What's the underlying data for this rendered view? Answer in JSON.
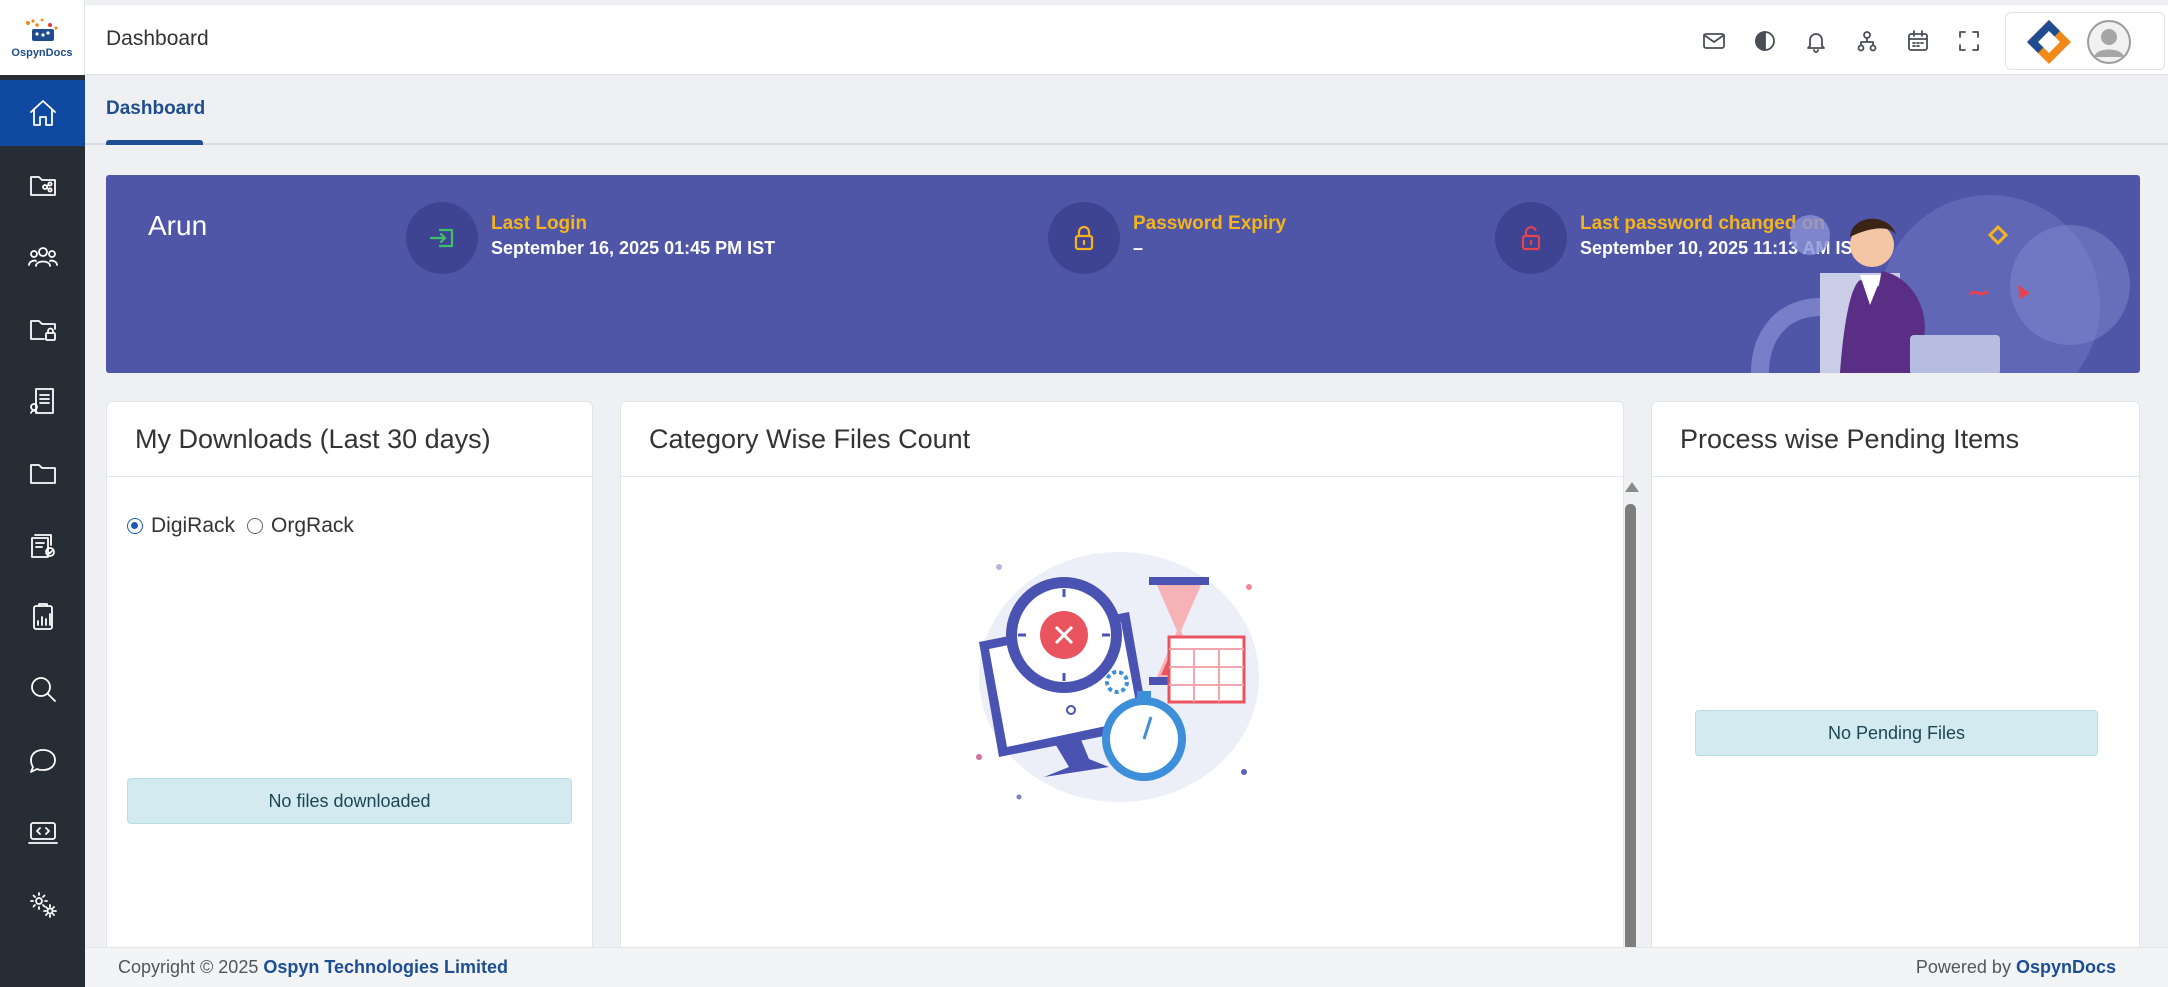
{
  "app": {
    "name": "OspynDocs"
  },
  "header": {
    "title": "Dashboard"
  },
  "header_icons": [
    "mail-icon",
    "theme-contrast-icon",
    "bell-icon",
    "org-hierarchy-icon",
    "calendar-icon",
    "fullscreen-icon"
  ],
  "sidebar": {
    "items": [
      {
        "icon": "home-icon",
        "active": true
      },
      {
        "icon": "shared-folder-icon"
      },
      {
        "icon": "users-icon"
      },
      {
        "icon": "locked-folder-icon"
      },
      {
        "icon": "document-icon"
      },
      {
        "icon": "folder-icon"
      },
      {
        "icon": "approval-docs-icon"
      },
      {
        "icon": "report-icon"
      },
      {
        "icon": "search-icon"
      },
      {
        "icon": "chat-icon"
      },
      {
        "icon": "code-screen-icon"
      },
      {
        "icon": "settings-icon"
      }
    ]
  },
  "tabs": [
    {
      "label": "Dashboard",
      "active": true
    }
  ],
  "banner": {
    "user_name": "Arun",
    "last_login_label": "Last Login",
    "last_login_value": "September 16, 2025 01:45 PM IST",
    "password_expiry_label": "Password Expiry",
    "password_expiry_value": "–",
    "last_password_changed_label": "Last password changed on",
    "last_password_changed_value": "September 10, 2025 11:13 AM IST",
    "colors": {
      "background": "#4f56a7",
      "label": "#f5b41d"
    }
  },
  "downloads_card": {
    "title": "My Downloads (Last 30 days)",
    "options": [
      {
        "label": "DigiRack",
        "checked": true
      },
      {
        "label": "OrgRack",
        "checked": false
      }
    ],
    "empty_message": "No files downloaded"
  },
  "category_card": {
    "title": "Category Wise Files Count"
  },
  "pending_card": {
    "title": "Process wise Pending Items",
    "empty_message": "No Pending Files"
  },
  "footer": {
    "copyright_prefix": "Copyright © 2025",
    "company": "Ospyn Technologies Limited",
    "powered_prefix": "Powered by",
    "powered_brand": "OspynDocs"
  }
}
